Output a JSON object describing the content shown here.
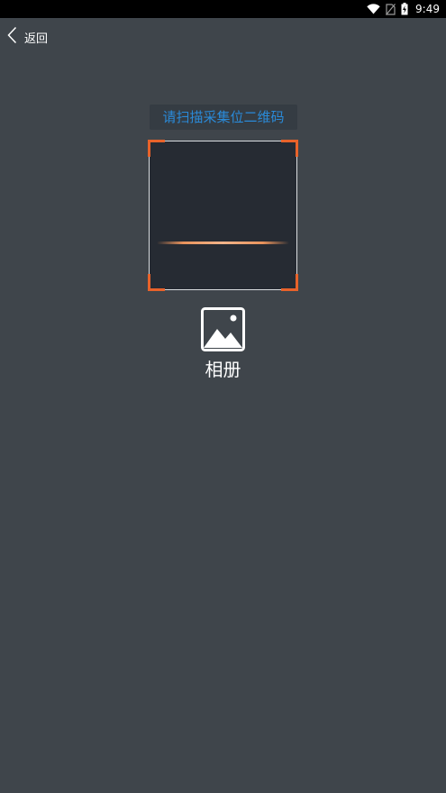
{
  "status_bar": {
    "time": "9:49",
    "icons": [
      "wifi-icon",
      "no-sim-icon",
      "battery-charging-icon"
    ]
  },
  "nav": {
    "back_icon": "chevron-left-icon",
    "back_label": "返回"
  },
  "scanner": {
    "hint": "请扫描采集位二维码",
    "accent_color": "#e8622a",
    "hint_color": "#2a8ad8"
  },
  "album": {
    "icon": "image-icon",
    "label": "相册"
  }
}
